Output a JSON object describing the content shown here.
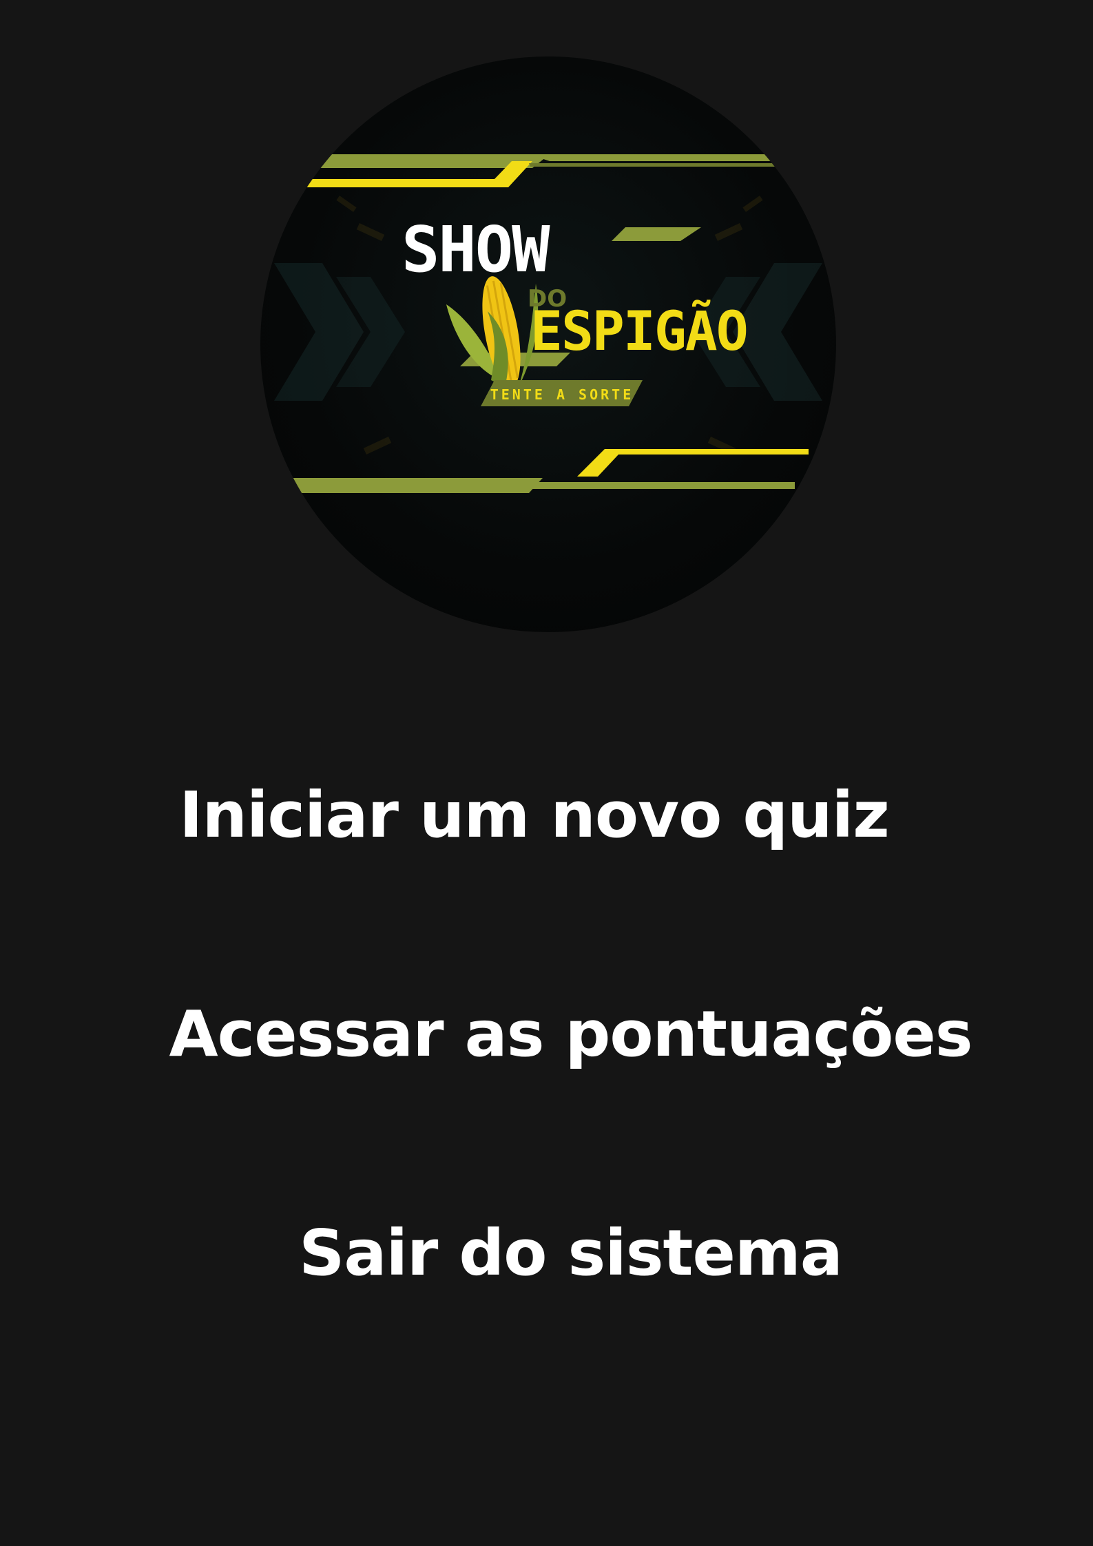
{
  "logo": {
    "title_line1": "SHOW",
    "title_small": "DO",
    "title_line2": "ESPIGÃO",
    "tagline": "TENTE A SORTE",
    "icon": "corn-icon",
    "colors": {
      "yellow": "#f2dc16",
      "olive": "#8c9b3a",
      "background": "#050707"
    }
  },
  "menu": {
    "items": [
      {
        "label": "Iniciar um novo quiz"
      },
      {
        "label": "Acessar as pontuações"
      },
      {
        "label": "Sair do sistema"
      }
    ]
  },
  "colors": {
    "page_background": "#151515",
    "text": "#ffffff"
  }
}
